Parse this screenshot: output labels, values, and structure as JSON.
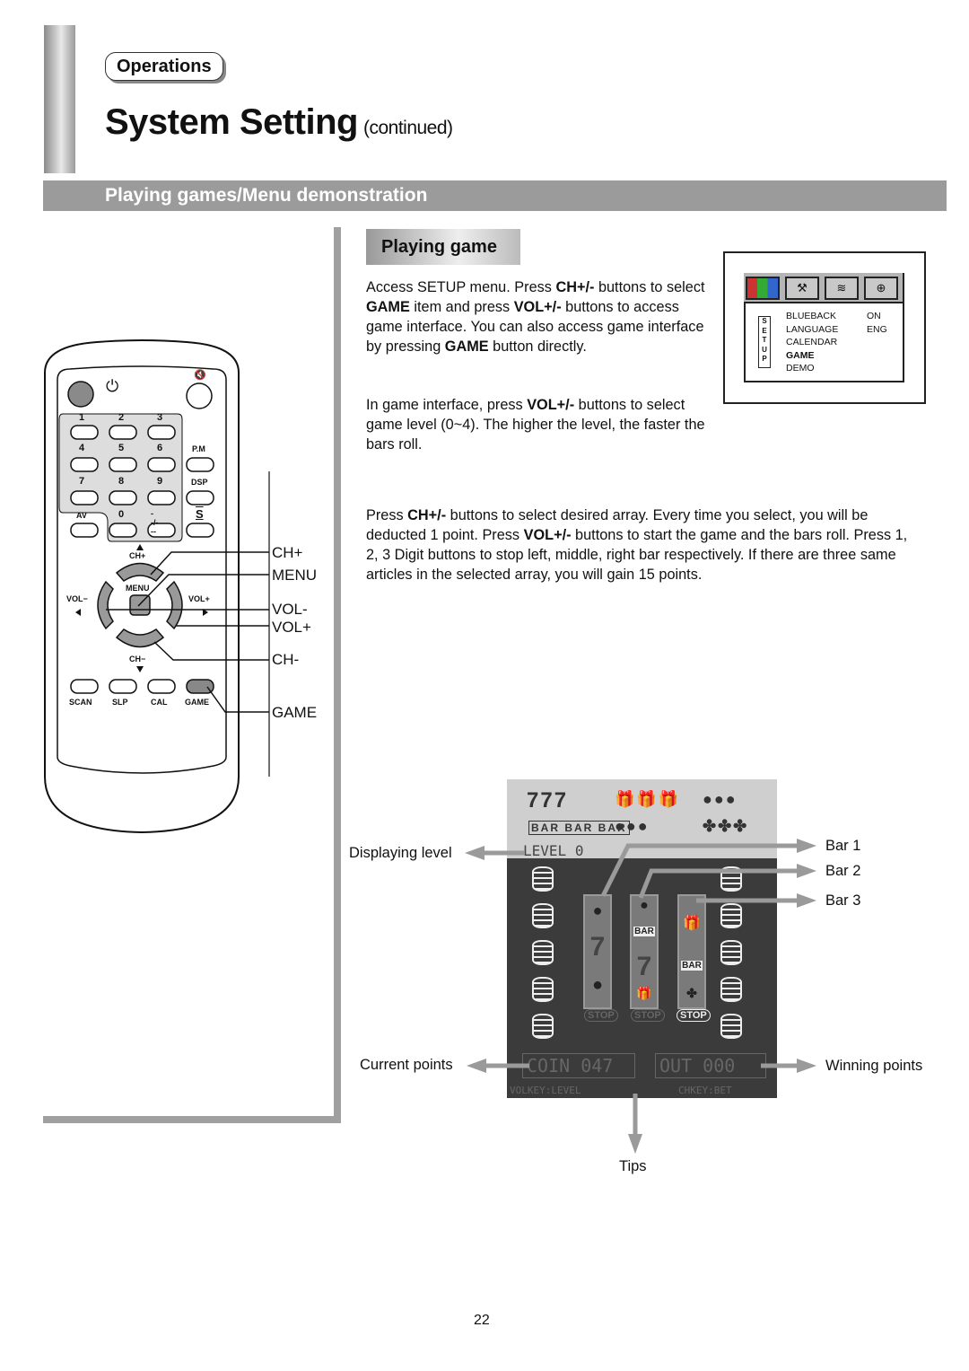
{
  "header": {
    "section_tag": "Operations",
    "title": "System Setting",
    "title_suffix": "(continued)",
    "section_heading": "Playing games/Menu demonstration"
  },
  "remote": {
    "keys": {
      "power_icon": "power-icon",
      "mute_icon": "mute-icon",
      "digits": [
        "1",
        "2",
        "3",
        "4",
        "5",
        "6",
        "7",
        "8",
        "9",
        "0"
      ],
      "pm": "P.M",
      "dsp": "DSP",
      "av": "AV",
      "dash": "--/---",
      "swap_symbol": "S",
      "ch_plus": "CH+",
      "ch_minus": "CH−",
      "menu": "MENU",
      "vol_minus": "VOL−",
      "vol_plus": "VOL+",
      "scan": "SCAN",
      "slp": "SLP",
      "cal": "CAL",
      "game": "GAME"
    },
    "callouts": [
      "CH+",
      "MENU",
      "VOL-",
      "VOL+",
      "CH-",
      "GAME"
    ]
  },
  "playing_game": {
    "heading": "Playing game",
    "p1": [
      {
        "t": "Access SETUP menu. Press ",
        "b": false
      },
      {
        "t": "CH+/-",
        "b": true
      },
      {
        "t": " buttons to select ",
        "b": false
      },
      {
        "t": "GAME",
        "b": true
      },
      {
        "t": " item and press ",
        "b": false
      },
      {
        "t": "VOL+/-",
        "b": true
      },
      {
        "t": " buttons to access game interface. You can also access game interface by pressing ",
        "b": false
      },
      {
        "t": "GAME",
        "b": true
      },
      {
        "t": " button directly.",
        "b": false
      }
    ],
    "p2": [
      {
        "t": "In game interface, press ",
        "b": false
      },
      {
        "t": "VOL+/-",
        "b": true
      },
      {
        "t": " buttons to select game level (0~4). The higher the level, the faster the bars roll.",
        "b": false
      }
    ],
    "p3": [
      {
        "t": "Press ",
        "b": false
      },
      {
        "t": "CH+/-",
        "b": true
      },
      {
        "t": " buttons to select desired array. Every time you select, you will be deducted 1 point. Press ",
        "b": false
      },
      {
        "t": "VOL+/-",
        "b": true
      },
      {
        "t": " buttons to start the game and the bars roll. Press 1, 2, 3 Digit buttons to stop left, middle, right bar respectively. If there are three same articles in the selected array, you will gain 15 points.",
        "b": false
      }
    ]
  },
  "setup_menu": {
    "tag": "SETUP",
    "icons": [
      "picture-icon",
      "tools-icon",
      "antenna-icon",
      "clock-icon"
    ],
    "rows": [
      {
        "label": "BLUEBACK",
        "value": "ON",
        "selected": false
      },
      {
        "label": "LANGUAGE",
        "value": "ENG",
        "selected": false
      },
      {
        "label": "CALENDAR",
        "value": "",
        "selected": false
      },
      {
        "label": "GAME",
        "value": "",
        "selected": true
      },
      {
        "label": "DEMO",
        "value": "",
        "selected": false
      }
    ]
  },
  "game_screen": {
    "paytable": [
      "777",
      "gift x3",
      "cherry x3",
      "BAR x3",
      "apple x3",
      "grape x3"
    ],
    "level_label": "LEVEL",
    "level_value": "0",
    "reels": [
      {
        "symbols": [
          "cherry",
          "7",
          "apple"
        ],
        "stop": "STOP"
      },
      {
        "symbols": [
          "BAR",
          "7",
          "gift"
        ],
        "stop": "STOP"
      },
      {
        "symbols": [
          "gift",
          "BAR",
          "grape"
        ],
        "stop": "STOP"
      }
    ],
    "coin_label": "COIN",
    "coin_value": "047",
    "out_label": "OUT",
    "out_value": "000",
    "tip_left": "VOLKEY:LEVEL",
    "tip_right": "CHKEY:BET"
  },
  "annotations": {
    "displaying_level": "Displaying level",
    "bar1": "Bar 1",
    "bar2": "Bar 2",
    "bar3": "Bar 3",
    "current_points": "Current points",
    "winning_points": "Winning points",
    "tips": "Tips"
  },
  "page_number": "22"
}
